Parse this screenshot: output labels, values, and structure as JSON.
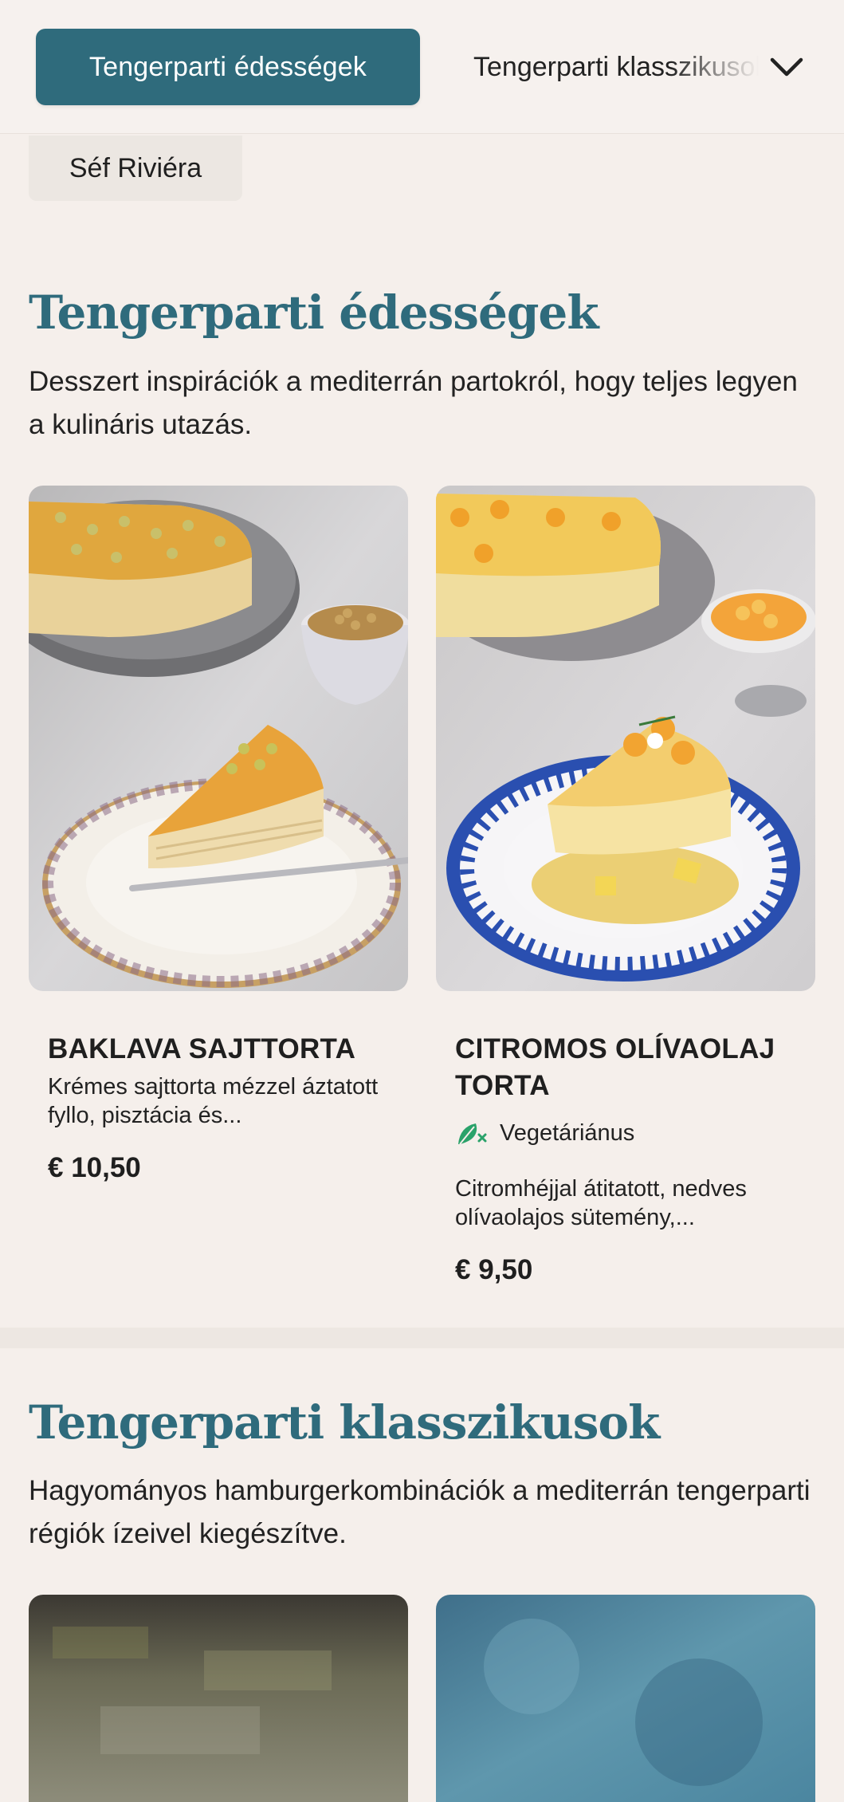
{
  "category_nav": {
    "active_tab": "Tengerparti édességek",
    "next_tab": "Tengerparti klasszikusok",
    "expand_icon": "chevron-down-icon"
  },
  "chef_chip": "Séf Riviéra",
  "sections": [
    {
      "title": "Tengerparti édességek",
      "description": "Desszert inspirációk a mediterrán partokról, hogy teljes legyen a kulináris utazás.",
      "items": [
        {
          "name": "BAKLAVA SAJTTORTA",
          "description": "Krémes sajttorta mézzel áztatott fyllo, pisztácia és...",
          "price": "€ 10,50"
        },
        {
          "name": "CITROMOS OLÍVAOLAJ TORTA",
          "badge": "Vegetáriánus",
          "badge_icon": "leaf-icon",
          "description": "Citromhéjjal átitatott, nedves olívaolajos sütemény,...",
          "price": "€ 9,50"
        }
      ]
    },
    {
      "title": "Tengerparti klasszikusok",
      "description": "Hagyományos hamburgerkombinációk a mediterrán tengerparti régiók ízeivel kiegészítve."
    }
  ],
  "colors": {
    "accent": "#2f6b7c",
    "background": "#f5efeb",
    "vegetarian_green": "#2aa26a"
  }
}
